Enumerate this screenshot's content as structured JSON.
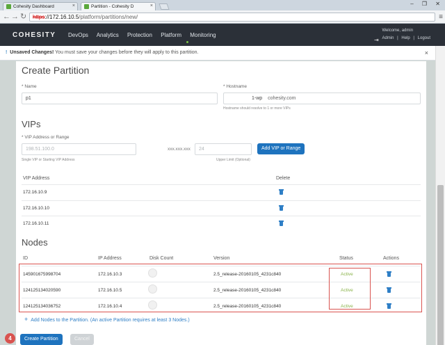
{
  "browser": {
    "tabs": [
      {
        "title": "Cohesity Dashboard",
        "close": "×"
      },
      {
        "title": "Partition - Cohesity D",
        "close": "×"
      }
    ],
    "window_controls": "– ❐ ✕",
    "url": {
      "scheme": "https",
      "host": "://172.16.10.5",
      "path": "/platform/partitions/new/"
    }
  },
  "app": {
    "logo": "COHESITY",
    "nav": [
      "DevOps",
      "Analytics",
      "Protection",
      "Platform",
      "Monitoring"
    ],
    "active_nav": "Platform",
    "welcome": "Welcome, admin",
    "user_links": [
      "Admin",
      "|",
      "Help",
      "|",
      "Logout"
    ]
  },
  "banner": {
    "title": "Unsaved Changes!",
    "message": "You must save your changes before they will apply to this partition.",
    "close": "×"
  },
  "form": {
    "page_title": "Create Partition",
    "name_label": "* Name",
    "name_value": "p1",
    "hostname_label": "* Hostname",
    "hostname_value": "1-wp",
    "hostname_suffix": "cohesity.com",
    "hostname_hint": "Hostname should resolve to 1 or more VIPs",
    "vips_title": "VIPs",
    "vip_label": "* VIP Address or Range",
    "vip_placeholder": "198.51.100.0",
    "vip_hint": "Single VIP or Starting VIP Address",
    "range_prefix": "xxx.xxx.xxx",
    "range_placeholder": "24",
    "range_hint": "Upper Limit (Optional)",
    "add_vip_button": "Add VIP or Range"
  },
  "vip_table": {
    "headers": [
      "VIP Address",
      "Delete"
    ],
    "rows": [
      "172.16.10.9",
      "172.16.10.10",
      "172.16.10.11"
    ]
  },
  "nodes": {
    "title": "Nodes",
    "headers": [
      "ID",
      "IP Address",
      "Disk Count",
      "Version",
      "Status",
      "Actions"
    ],
    "rows": [
      {
        "id": "145901675998704",
        "ip": "172.16.10.3",
        "version": "2.5_release-20160105_4231c840",
        "status": "Active"
      },
      {
        "id": "124125134020590",
        "ip": "172.16.10.5",
        "version": "2.5_release-20160105_4231c840",
        "status": "Active"
      },
      {
        "id": "124125134036752",
        "ip": "172.16.10.4",
        "version": "2.5_release-20160105_4231c840",
        "status": "Active"
      }
    ],
    "add_link": "Add Nodes to the Partition. (An active Partition requires at least 3 Nodes.)"
  },
  "actions": {
    "create_button": "Create Partition",
    "cancel_button": "Cancel",
    "step_badge": "4"
  },
  "colors": {
    "header_bg": "#2b3038",
    "primary": "#1e73be",
    "active_status": "#8ab34a",
    "highlight": "#d9534f"
  }
}
